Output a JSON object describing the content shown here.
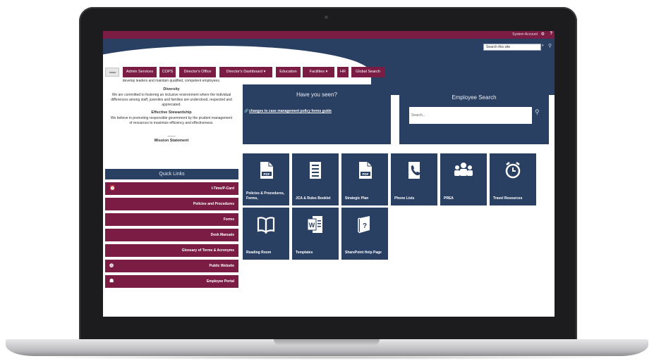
{
  "header": {
    "system_account": "System Account",
    "search_placeholder": "Search this site"
  },
  "nav": {
    "tabs": [
      {
        "label": "Admin Services"
      },
      {
        "label": "COPS"
      },
      {
        "label": "Director's Office"
      },
      {
        "label": "Director's Dashboard ▾"
      },
      {
        "label": "Education"
      },
      {
        "label": "Facilities ▾"
      },
      {
        "label": "HR"
      },
      {
        "label": "Global Search"
      }
    ]
  },
  "left": {
    "intro_line": "develop leaders and maintain qualified, competent employees.",
    "diversity_title": "Diversity",
    "diversity_text": "We are committed to fostering an inclusive environment where the individual differences among staff, juveniles and families are understood, respected and appreciated.",
    "stewardship_title": "Effective Stewardship",
    "stewardship_text": "We believe in promoting responsible government by the prudent management of resources to maximize efficiency and effectiveness.",
    "divider": "____",
    "mission_label": "Mission Statement"
  },
  "quick_links": {
    "title": "Quick Links",
    "items": [
      {
        "label": "I-Time/P-Card",
        "icon": "alarm-clock-icon"
      },
      {
        "label": "Policies and Procedures",
        "icon": ""
      },
      {
        "label": "Forms",
        "icon": ""
      },
      {
        "label": "Desk Manuals",
        "icon": ""
      },
      {
        "label": "Glossary of Terms & Acronyms",
        "icon": ""
      },
      {
        "label": "Public Website",
        "icon": "globe-icon"
      },
      {
        "label": "Employee Portal",
        "icon": "people-icon"
      }
    ]
  },
  "have_you_seen": {
    "title": "Have you seen?",
    "link_text": "changes to case management policy forms guide"
  },
  "employee_search": {
    "title": "Employee Search",
    "placeholder": "Search..."
  },
  "tiles": [
    {
      "label": "Policies & Procedures, Forms,",
      "icon": "pdf-icon"
    },
    {
      "label": "JCA & Rules Booklet",
      "icon": "list-document-icon"
    },
    {
      "label": "Strategic Plan",
      "icon": "pdf-icon"
    },
    {
      "label": "Phone Lists",
      "icon": "phone-book-icon"
    },
    {
      "label": "PREA",
      "icon": "people-group-icon"
    },
    {
      "label": "Travel Resources",
      "icon": "alarm-clock-icon"
    },
    {
      "label": "Reading Room",
      "icon": "open-book-icon"
    },
    {
      "label": "Templates",
      "icon": "word-document-icon"
    },
    {
      "label": "SharePoint Help Page",
      "icon": "help-book-icon"
    }
  ],
  "colors": {
    "maroon": "#7b1c45",
    "navy": "#2a4062",
    "white": "#ffffff"
  }
}
